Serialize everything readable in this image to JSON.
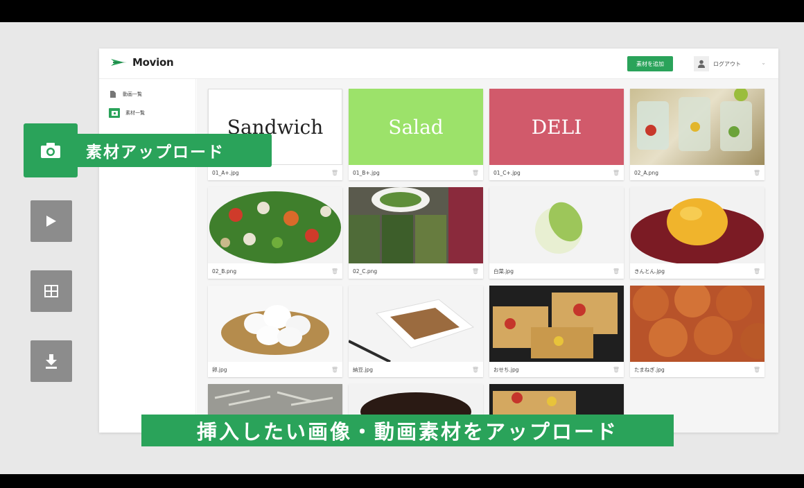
{
  "app": {
    "logo_text": "Movion",
    "add_button": "素材を追加",
    "logout": "ログアウト"
  },
  "sidebar": {
    "items": [
      {
        "label": "動画一覧",
        "icon": "document-icon",
        "active": false
      },
      {
        "label": "素材一覧",
        "icon": "image-icon",
        "active": true
      }
    ]
  },
  "materials": [
    {
      "file": "01_A+.jpg",
      "title": "Sandwich"
    },
    {
      "file": "01_B+.jpg",
      "title": "Salad"
    },
    {
      "file": "01_C+.jpg",
      "title": "DELI"
    },
    {
      "file": "02_A.png"
    },
    {
      "file": "02_B.png"
    },
    {
      "file": "02_C.png"
    },
    {
      "file": "白菜.jpg"
    },
    {
      "file": "きんとん.jpg"
    },
    {
      "file": "卵.jpg"
    },
    {
      "file": "納豆.jpg"
    },
    {
      "file": "おせち.jpg"
    },
    {
      "file": "たまねぎ.jpg"
    }
  ],
  "overlay": {
    "upload_label": "素材アップロード",
    "subtitle": "挿入したい画像・動画素材をアップロード"
  },
  "colors": {
    "accent": "#2aa35a",
    "tool_gray": "#8c8c8c"
  }
}
